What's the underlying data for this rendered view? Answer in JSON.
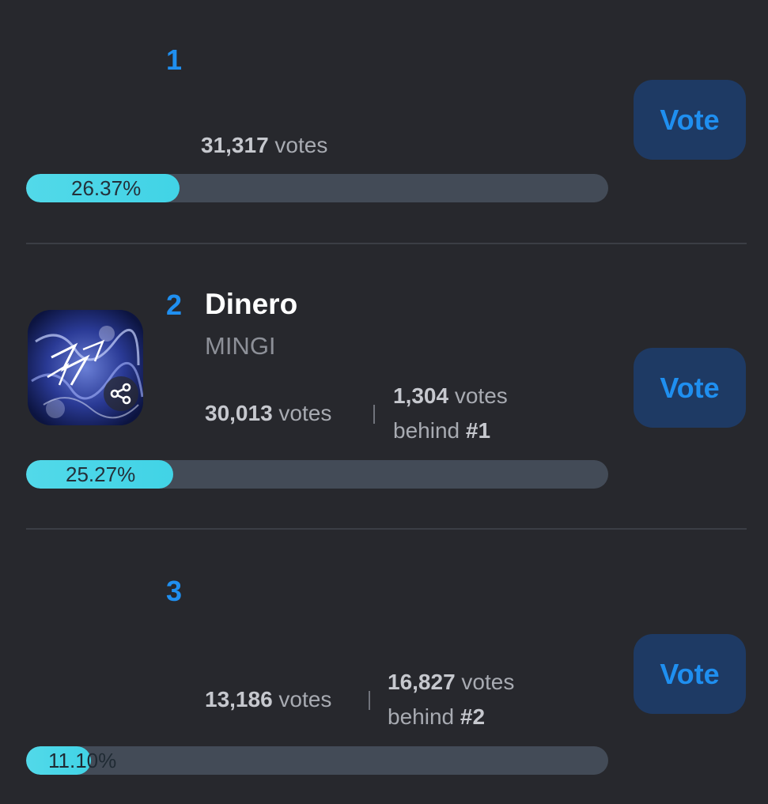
{
  "entries": [
    {
      "rank": "1",
      "title": "",
      "artist": "",
      "votes_count": "31,317",
      "votes_word": "votes",
      "behind_count": "",
      "behind_word": "",
      "behind_label": "",
      "percent_label": "26.37%",
      "percent": 26.37,
      "vote_label": "Vote"
    },
    {
      "rank": "2",
      "title": "Dinero",
      "artist": "MINGI",
      "votes_count": "30,013",
      "votes_word": "votes",
      "behind_count": "1,304",
      "behind_word": "votes",
      "behind_label_prefix": "behind",
      "behind_label_rank": "#1",
      "percent_label": "25.27%",
      "percent": 25.27,
      "vote_label": "Vote"
    },
    {
      "rank": "3",
      "title": "",
      "artist": "",
      "votes_count": "13,186",
      "votes_word": "votes",
      "behind_count": "16,827",
      "behind_word": "votes",
      "behind_label_prefix": "behind",
      "behind_label_rank": "#2",
      "percent_label": "11.10%",
      "percent": 11.1,
      "vote_label": "Vote"
    }
  ],
  "colors": {
    "background": "#27282d",
    "accent": "#1f8ff0",
    "vote_button_bg": "#1e3a64",
    "bar_track": "#434b57",
    "bar_fill": "#4fd8e8"
  },
  "icons": {
    "share": "share-icon"
  }
}
